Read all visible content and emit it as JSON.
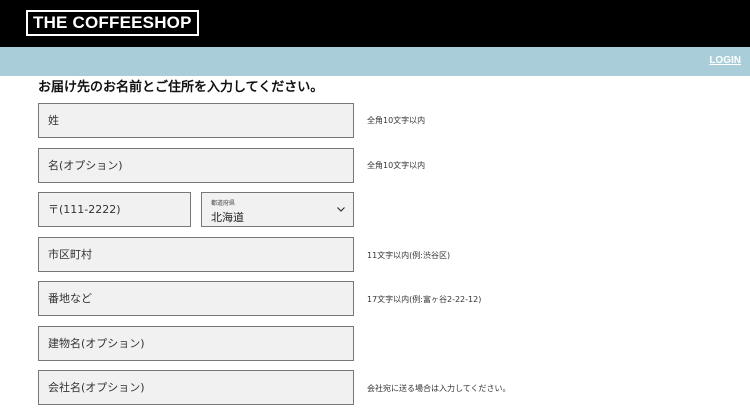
{
  "header": {
    "logo": "THE COFFEESHOP",
    "login": "LOGIN"
  },
  "form": {
    "title": "お届け先のお名前とご住所を入力してください。",
    "last_name": {
      "placeholder": "姓",
      "hint": "全角10文字以内"
    },
    "first_name": {
      "placeholder": "名(オプション)",
      "hint": "全角10文字以内"
    },
    "postal": {
      "placeholder": "〒(111-2222)"
    },
    "prefecture": {
      "label": "都道府県",
      "value": "北海道"
    },
    "city": {
      "placeholder": "市区町村",
      "hint": "11文字以内(例:渋谷区)"
    },
    "address": {
      "placeholder": "番地など",
      "hint": "17文字以内(例:富ヶ谷2-22-12)"
    },
    "building": {
      "placeholder": "建物名(オプション)"
    },
    "company": {
      "placeholder": "会社名(オプション)",
      "hint": "会社宛に送る場合は入力してください。"
    }
  },
  "colors": {
    "topbar": "#000000",
    "subbar": "#a9cdd9",
    "field_bg": "#f1f1f1",
    "field_border": "#777777"
  }
}
